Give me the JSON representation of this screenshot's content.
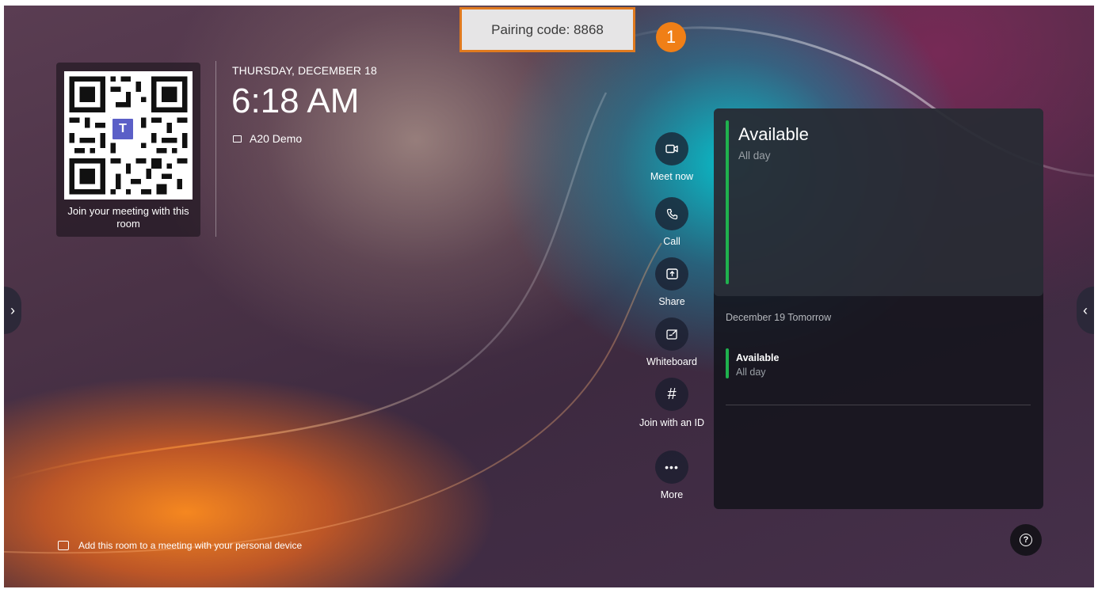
{
  "header": {
    "pairing_label": "Pairing code: 8868",
    "callout_number": "1"
  },
  "qr": {
    "caption": "Join your meeting with this room",
    "logo": "T"
  },
  "clock": {
    "date": "THURSDAY, DECEMBER 18",
    "time": "6:18 AM",
    "room_name": "A20 Demo"
  },
  "actions": [
    {
      "label": "Meet now",
      "icon": "video-camera-icon"
    },
    {
      "label": "Call",
      "icon": "phone-icon"
    },
    {
      "label": "Share",
      "icon": "share-screen-icon"
    },
    {
      "label": "Whiteboard",
      "icon": "whiteboard-icon"
    },
    {
      "label": "Join with an ID",
      "icon": "hash-icon"
    },
    {
      "label": "More",
      "icon": "more-icon"
    }
  ],
  "calendar": {
    "today_title": "Available",
    "today_sub": "All day",
    "tomorrow_label": "December 19 Tomorrow",
    "tomorrow_title": "Available",
    "tomorrow_sub": "All day"
  },
  "footer": {
    "note": "Add this room to a meeting with your personal device",
    "help_icon": "question-icon"
  },
  "colors": {
    "accent_orange": "#f07f16",
    "status_green": "#1fb14e",
    "teams_purple": "#5b5fc7"
  }
}
